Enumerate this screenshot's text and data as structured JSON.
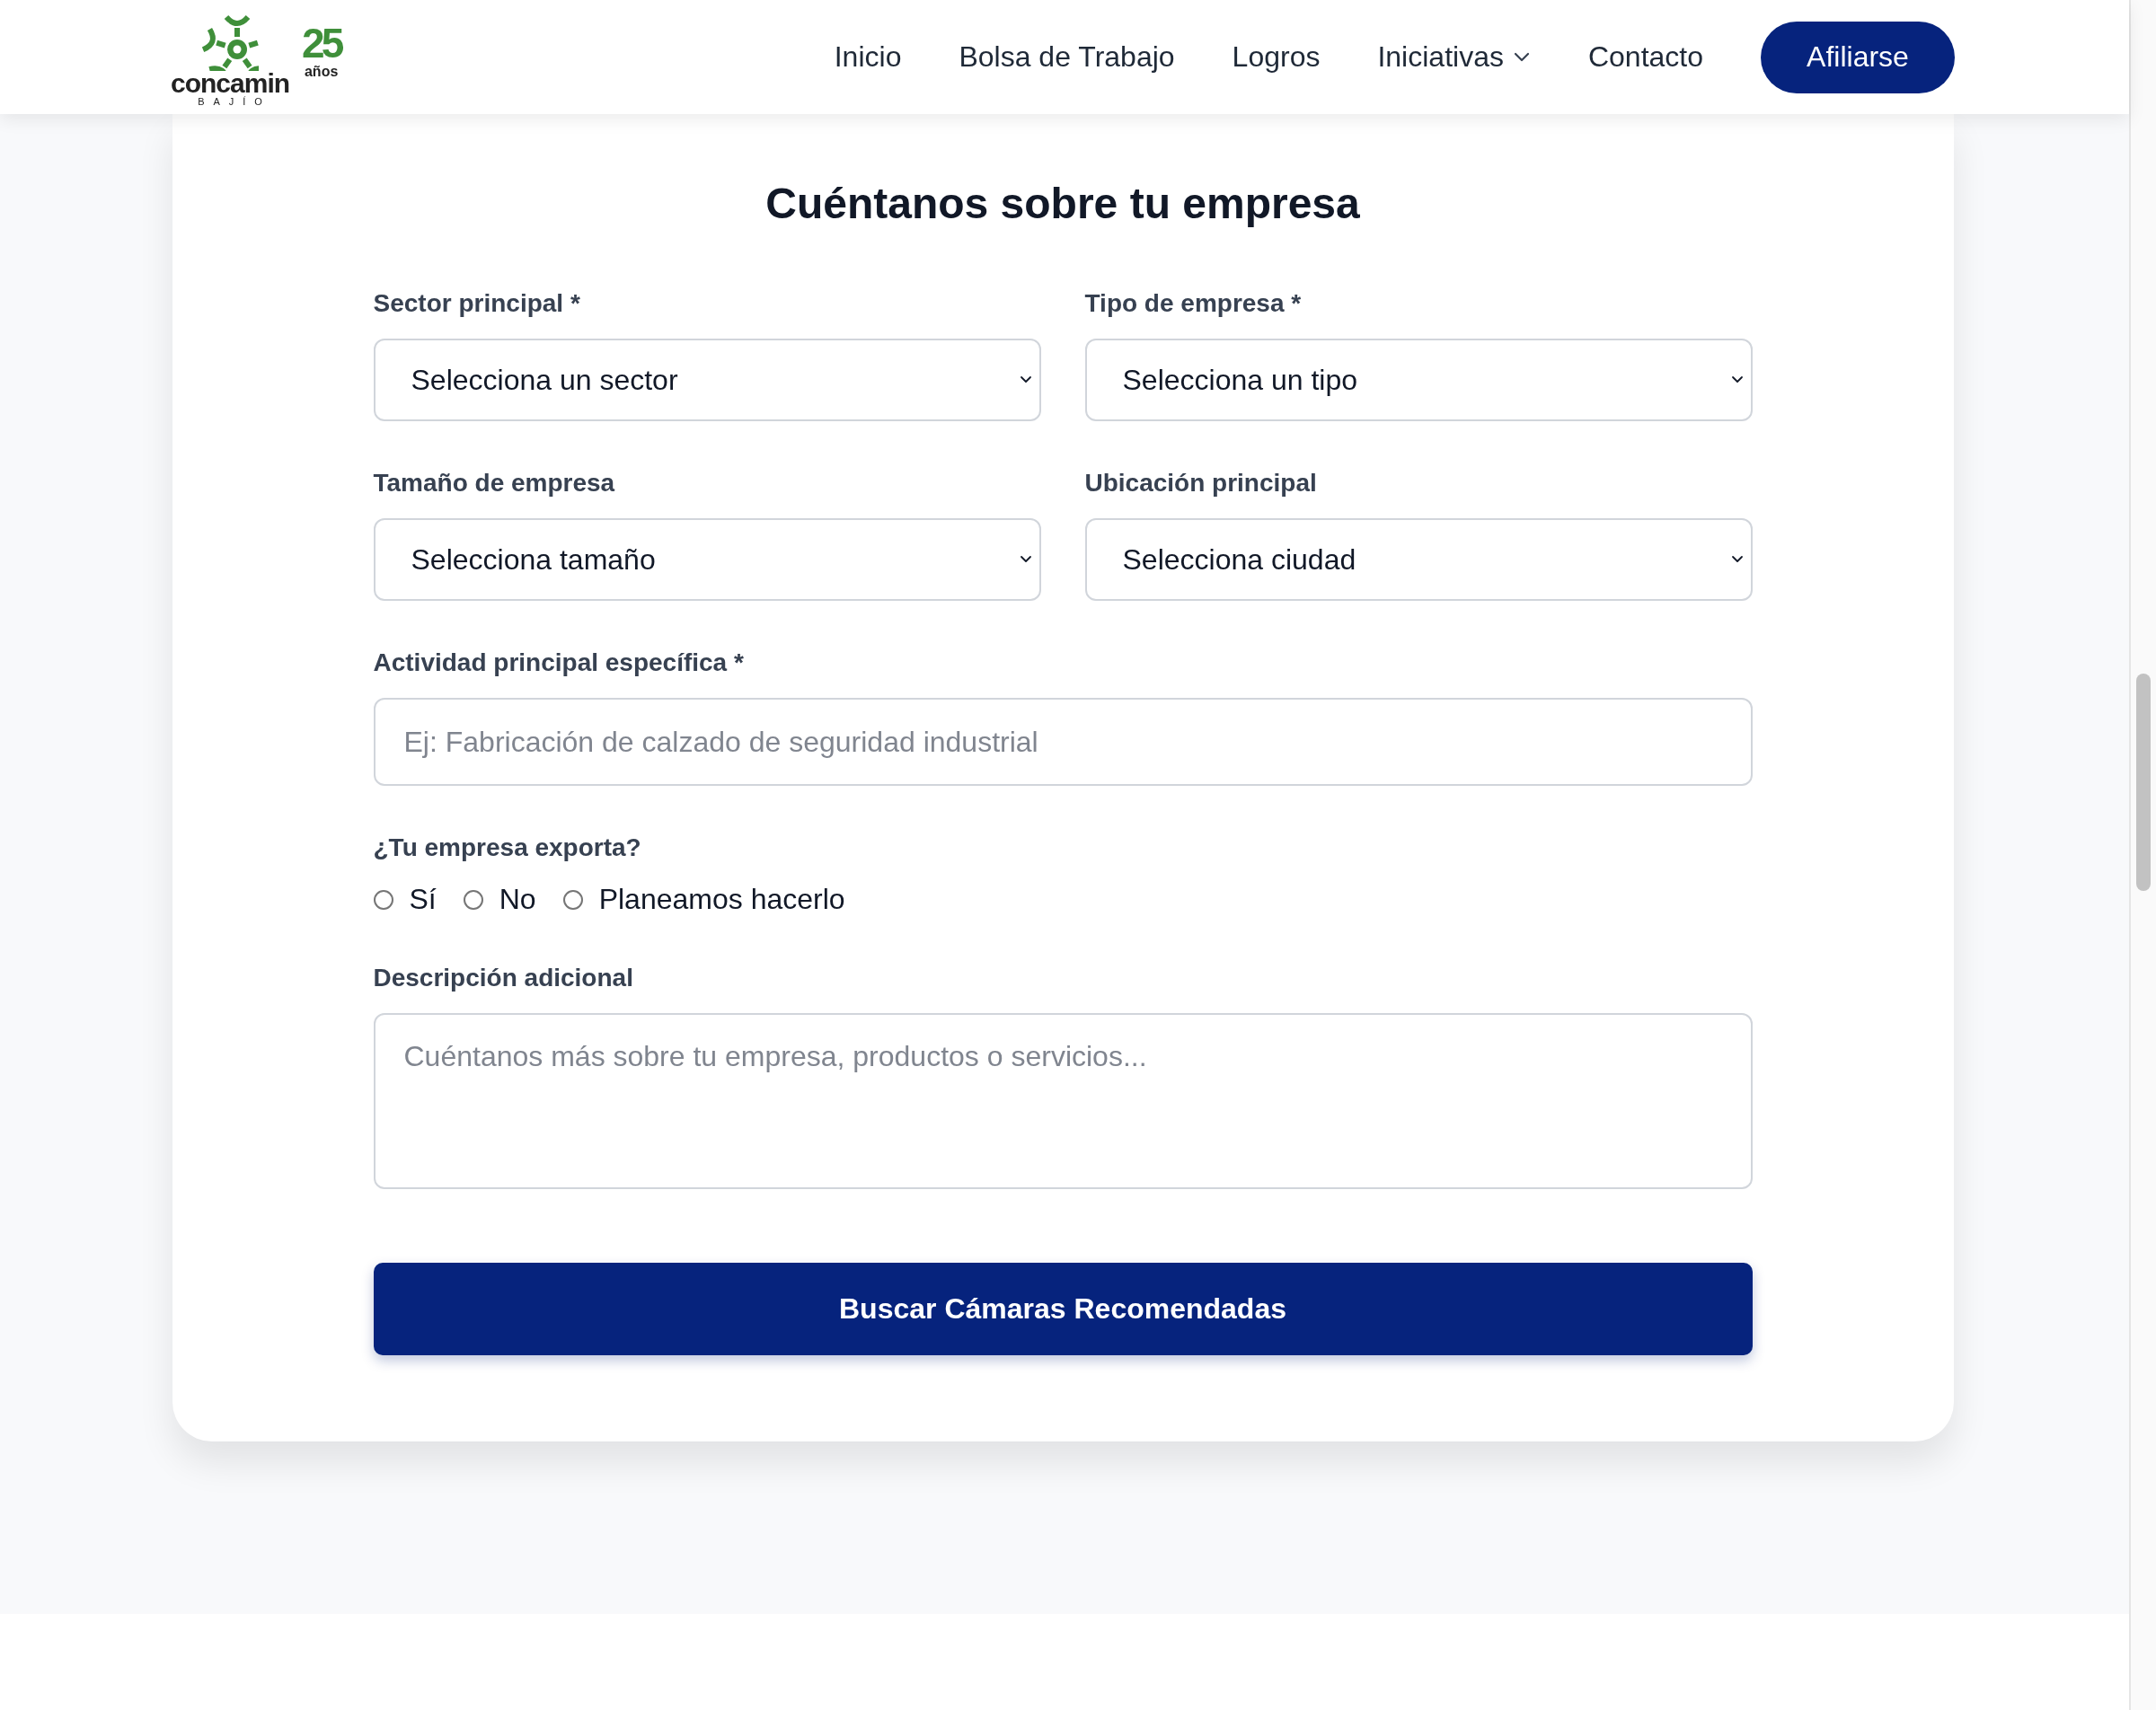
{
  "header": {
    "logo": {
      "wordmark": "concamin",
      "subtitle": "BAJÍO",
      "anniversary_number": "25",
      "anniversary_word": "años"
    },
    "nav": [
      {
        "label": "Inicio",
        "has_dropdown": false
      },
      {
        "label": "Bolsa de Trabajo",
        "has_dropdown": false
      },
      {
        "label": "Logros",
        "has_dropdown": false
      },
      {
        "label": "Iniciativas",
        "has_dropdown": true
      },
      {
        "label": "Contacto",
        "has_dropdown": false
      }
    ],
    "cta": "Afiliarse"
  },
  "form": {
    "title": "Cuéntanos sobre tu empresa",
    "fields": [
      {
        "kind": "select",
        "label": "Sector principal *",
        "value": "Selecciona un sector"
      },
      {
        "kind": "select",
        "label": "Tipo de empresa *",
        "value": "Selecciona un tipo"
      },
      {
        "kind": "select",
        "label": "Tamaño de empresa",
        "value": "Selecciona tamaño"
      },
      {
        "kind": "select",
        "label": "Ubicación principal",
        "value": "Selecciona ciudad"
      },
      {
        "kind": "text",
        "label": "Actividad principal específica *",
        "placeholder": "Ej: Fabricación de calzado de seguridad industrial"
      },
      {
        "kind": "radio",
        "label": "¿Tu empresa exporta?",
        "options": [
          {
            "label": "Sí",
            "selected": false
          },
          {
            "label": "No",
            "selected": false
          },
          {
            "label": "Planeamos hacerlo",
            "selected": false
          }
        ]
      },
      {
        "kind": "textarea",
        "label": "Descripción adicional",
        "placeholder": "Cuéntanos más sobre tu empresa, productos o servicios..."
      }
    ],
    "submit": "Buscar Cámaras Recomendadas"
  }
}
